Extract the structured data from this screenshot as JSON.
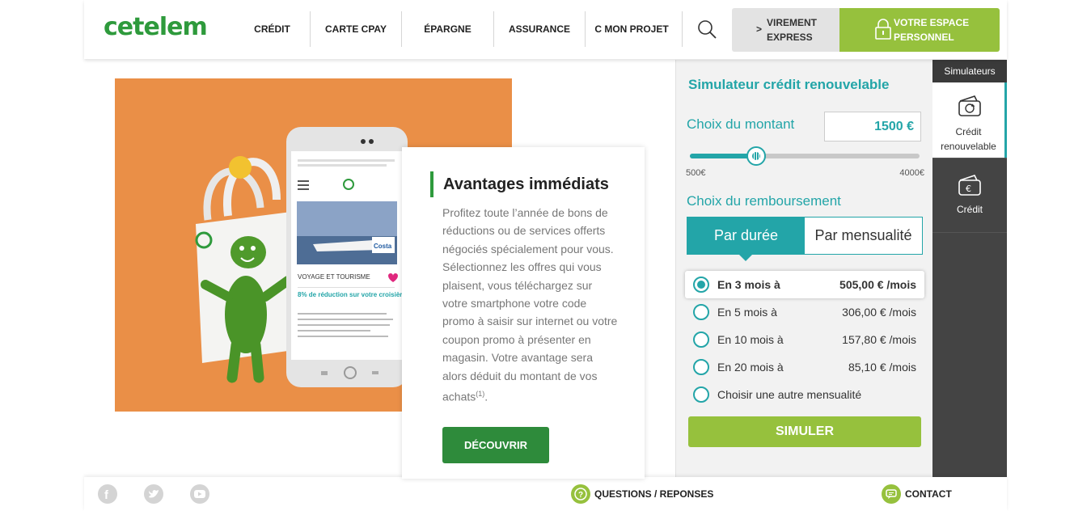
{
  "header": {
    "logo": "cetelem",
    "nav": [
      "CRÉDIT",
      "CARTE CPAY",
      "ÉPARGNE",
      "ASSURANCE",
      "C MON PROJET"
    ],
    "virement_label": "VIREMENT EXPRESS",
    "espace_label": "VOTRE ESPACE PERSONNEL"
  },
  "promo": {
    "title": "Avantages immédiats",
    "text": "Profitez toute l’année de bons de réductions ou de services offerts négociés spécialement pour vous. Sélectionnez les offres qui vous plaisent, vous téléchargez sur votre smartphone votre code promo à saisir sur internet ou votre coupon promo à présenter en magasin. Votre avantage sera alors déduit du montant de vos achats",
    "note": "(1)",
    "button": "DÉCOUVRIR",
    "phone": {
      "category": "VOYAGE ET TOURISME",
      "headline": "8% de réduction sur votre croisière",
      "brand": "Costa"
    }
  },
  "simulator": {
    "title": "Simulateur crédit renouvelable",
    "amount_label": "Choix du montant",
    "amount_value": "1500 €",
    "slider_min": "500€",
    "slider_max": "4000€",
    "slider_fraction": 0.29,
    "repay_label": "Choix du remboursement",
    "tabs": [
      "Par durée",
      "Par mensualité"
    ],
    "options": [
      {
        "label": "En 3 mois à",
        "value": "505,00 € /mois",
        "selected": true
      },
      {
        "label": "En 5 mois à",
        "value": "306,00 € /mois",
        "selected": false
      },
      {
        "label": "En 10 mois à",
        "value": "157,80 € /mois",
        "selected": false
      },
      {
        "label": "En 20 mois à",
        "value": "85,10 € /mois",
        "selected": false
      },
      {
        "label": "Choisir une autre mensualité",
        "value": "",
        "selected": false
      }
    ],
    "submit": "SIMULER"
  },
  "side_panel": {
    "header": "Simulateurs",
    "items": [
      {
        "label": "Crédit renouvelable",
        "icon": "wallet-refresh-icon"
      },
      {
        "label": "Crédit",
        "icon": "wallet-euro-icon"
      }
    ]
  },
  "footer": {
    "social": [
      "facebook-icon",
      "twitter-icon",
      "youtube-icon"
    ],
    "questions": "QUESTIONS / REPONSES",
    "contact": "CONTACT"
  },
  "colors": {
    "brand_green": "#2e9a3c",
    "lime": "#96c13d",
    "teal": "#23a5a8",
    "promo_orange": "#ea8f47"
  }
}
